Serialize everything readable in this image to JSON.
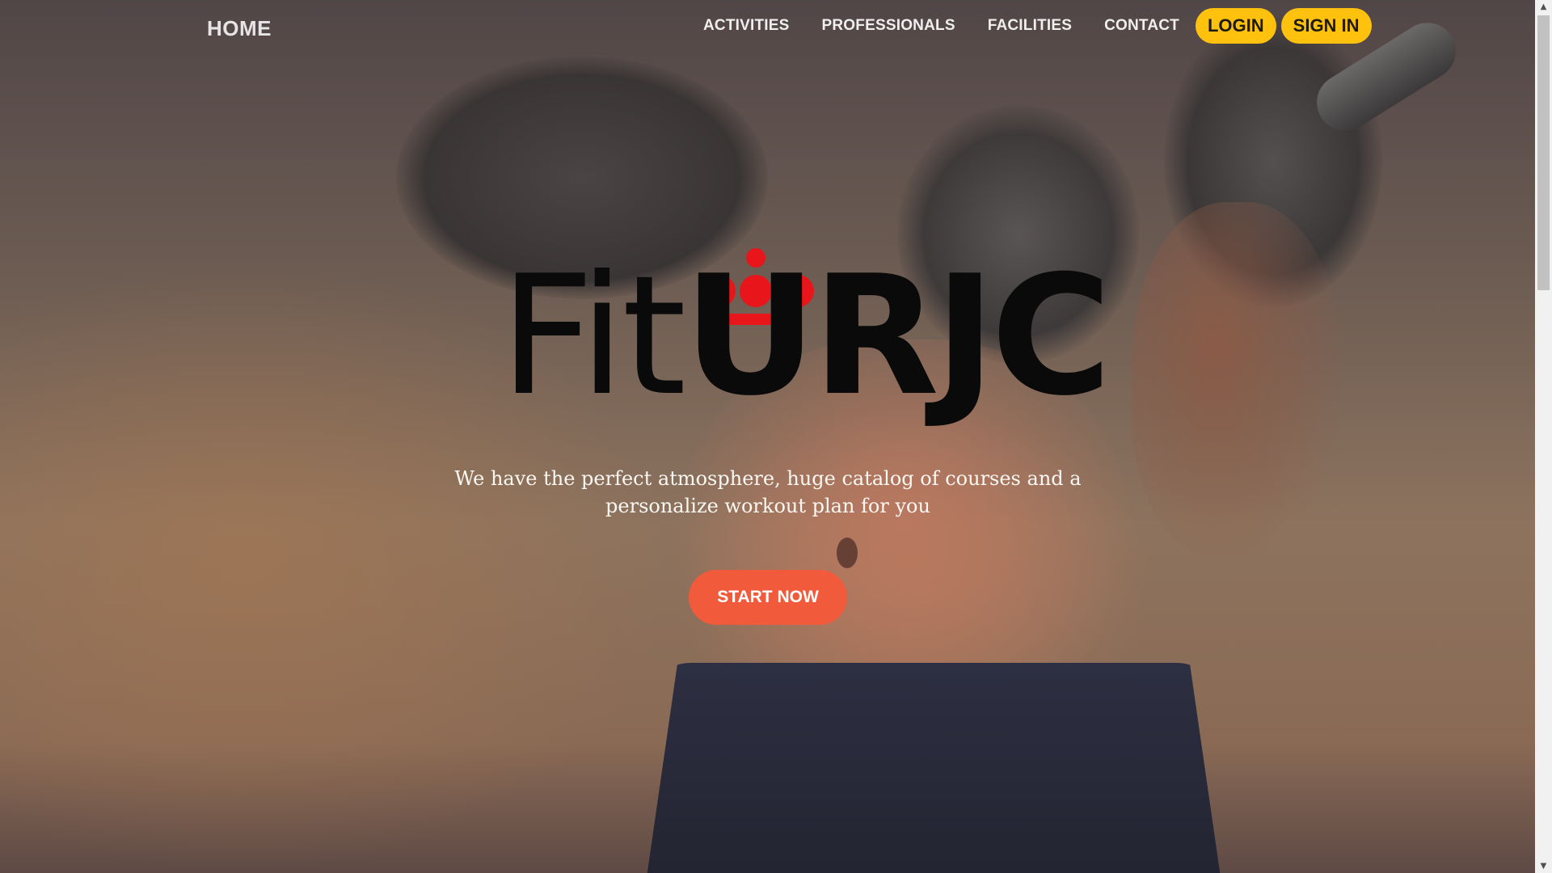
{
  "nav": {
    "home_label": "HOME",
    "links": [
      {
        "label": "ACTIVITIES"
      },
      {
        "label": "PROFESSIONALS"
      },
      {
        "label": "FACILITIES"
      },
      {
        "label": "CONTACT"
      }
    ],
    "login_label": "LOGIN",
    "signin_label": "SIGN IN",
    "button_color": "#fdc10e"
  },
  "hero": {
    "logo_text_fit": "Fit",
    "logo_text_urjc": "URJC",
    "logo_accent_color": "#e8151b",
    "tagline": "We have the perfect atmosphere, huge catalog of courses and a personalize workout plan for you",
    "cta_label": "START NOW",
    "cta_color": "#f15a3b"
  },
  "scrollbar": {
    "up_icon": "▲",
    "down_icon": "▼"
  }
}
